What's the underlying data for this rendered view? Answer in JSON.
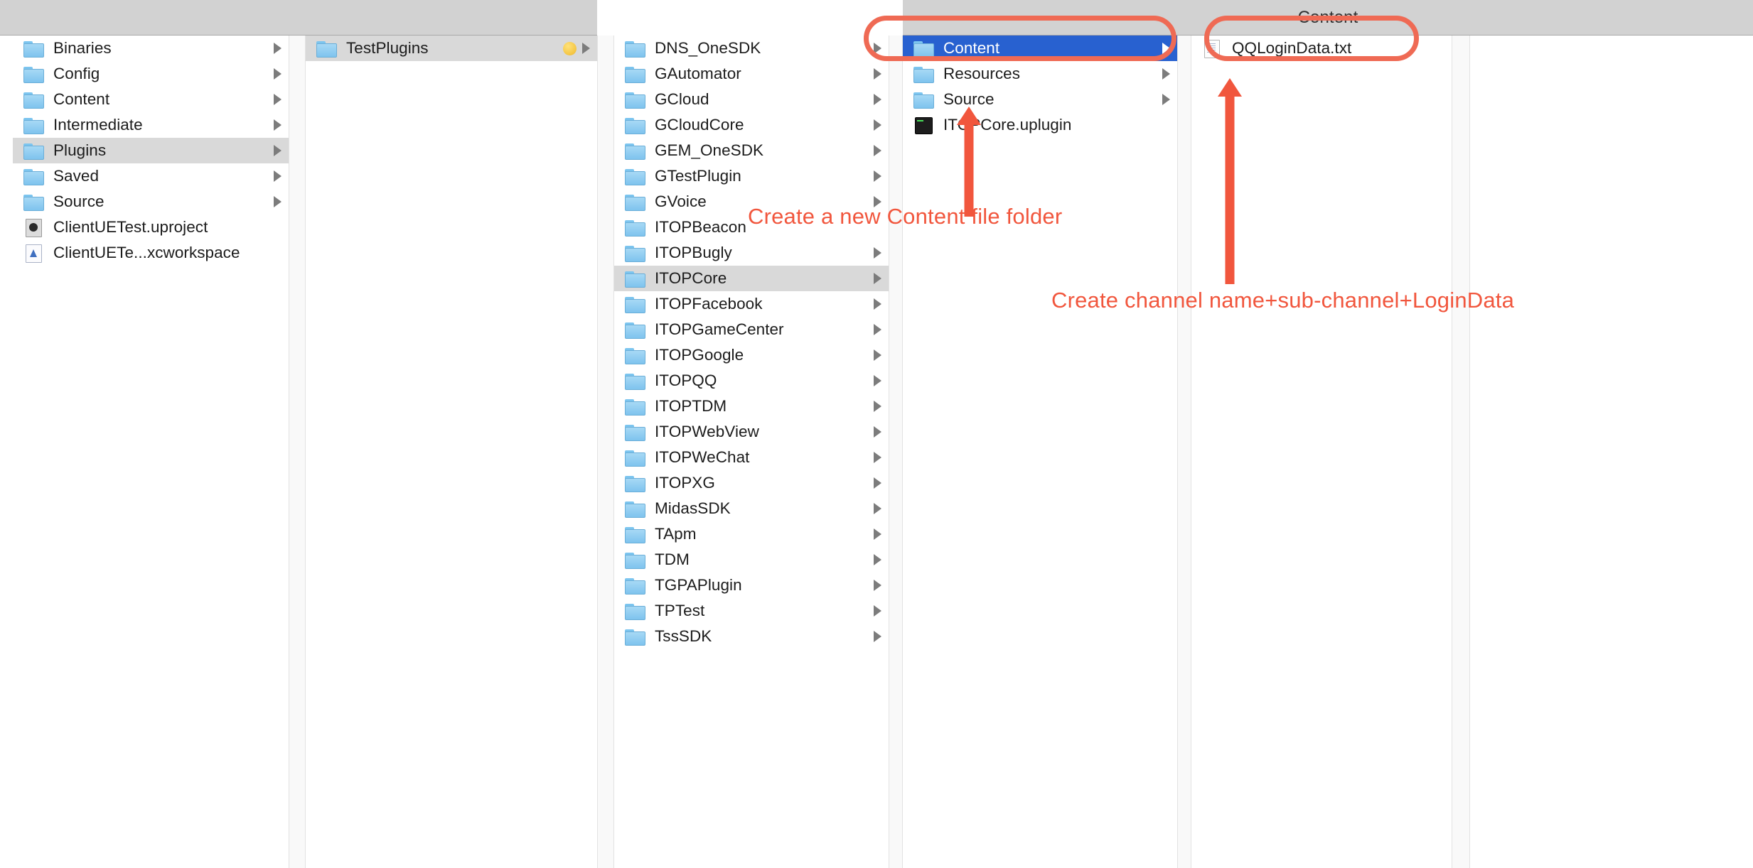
{
  "window": {
    "right_pane_title": "Content",
    "accent_selected": "#2861d0",
    "annotation_color": "#f1563d"
  },
  "columns": [
    {
      "id": "col-1",
      "items": [
        {
          "label": "Binaries",
          "icon": "folder-icon",
          "chevron": true,
          "state": "normal"
        },
        {
          "label": "Config",
          "icon": "folder-icon",
          "chevron": true,
          "state": "normal"
        },
        {
          "label": "Content",
          "icon": "folder-icon",
          "chevron": true,
          "state": "normal"
        },
        {
          "label": "Intermediate",
          "icon": "folder-icon",
          "chevron": true,
          "state": "normal"
        },
        {
          "label": "Plugins",
          "icon": "folder-icon",
          "chevron": true,
          "state": "selected-gray"
        },
        {
          "label": "Saved",
          "icon": "folder-icon",
          "chevron": true,
          "state": "normal"
        },
        {
          "label": "Source",
          "icon": "folder-icon",
          "chevron": true,
          "state": "normal"
        },
        {
          "label": "ClientUETest.uproject",
          "icon": "unreal-project-icon",
          "chevron": false,
          "state": "normal"
        },
        {
          "label": "ClientUETe...xcworkspace",
          "icon": "xcode-workspace-icon",
          "chevron": false,
          "state": "normal"
        }
      ]
    },
    {
      "id": "col-2",
      "items": [
        {
          "label": "TestPlugins",
          "icon": "folder-icon",
          "chevron": true,
          "state": "selected-gray",
          "tag": "yellow-tag-dot"
        }
      ]
    },
    {
      "id": "col-3",
      "items": [
        {
          "label": "DNS_OneSDK",
          "icon": "folder-icon",
          "chevron": true,
          "state": "normal"
        },
        {
          "label": "GAutomator",
          "icon": "folder-icon",
          "chevron": true,
          "state": "normal"
        },
        {
          "label": "GCloud",
          "icon": "folder-icon",
          "chevron": true,
          "state": "normal"
        },
        {
          "label": "GCloudCore",
          "icon": "folder-icon",
          "chevron": true,
          "state": "normal"
        },
        {
          "label": "GEM_OneSDK",
          "icon": "folder-icon",
          "chevron": true,
          "state": "normal"
        },
        {
          "label": "GTestPlugin",
          "icon": "folder-icon",
          "chevron": true,
          "state": "normal"
        },
        {
          "label": "GVoice",
          "icon": "folder-icon",
          "chevron": true,
          "state": "normal"
        },
        {
          "label": "ITOPBeacon",
          "icon": "folder-icon",
          "chevron": false,
          "state": "normal"
        },
        {
          "label": "ITOPBugly",
          "icon": "folder-icon",
          "chevron": true,
          "state": "normal"
        },
        {
          "label": "ITOPCore",
          "icon": "folder-icon",
          "chevron": true,
          "state": "selected-gray"
        },
        {
          "label": "ITOPFacebook",
          "icon": "folder-icon",
          "chevron": true,
          "state": "normal"
        },
        {
          "label": "ITOPGameCenter",
          "icon": "folder-icon",
          "chevron": true,
          "state": "normal"
        },
        {
          "label": "ITOPGoogle",
          "icon": "folder-icon",
          "chevron": true,
          "state": "normal"
        },
        {
          "label": "ITOPQQ",
          "icon": "folder-icon",
          "chevron": true,
          "state": "normal"
        },
        {
          "label": "ITOPTDM",
          "icon": "folder-icon",
          "chevron": true,
          "state": "normal"
        },
        {
          "label": "ITOPWebView",
          "icon": "folder-icon",
          "chevron": true,
          "state": "normal"
        },
        {
          "label": "ITOPWeChat",
          "icon": "folder-icon",
          "chevron": true,
          "state": "normal"
        },
        {
          "label": "ITOPXG",
          "icon": "folder-icon",
          "chevron": true,
          "state": "normal"
        },
        {
          "label": "MidasSDK",
          "icon": "folder-icon",
          "chevron": true,
          "state": "normal"
        },
        {
          "label": "TApm",
          "icon": "folder-icon",
          "chevron": true,
          "state": "normal"
        },
        {
          "label": "TDM",
          "icon": "folder-icon",
          "chevron": true,
          "state": "normal"
        },
        {
          "label": "TGPAPlugin",
          "icon": "folder-icon",
          "chevron": true,
          "state": "normal"
        },
        {
          "label": "TPTest",
          "icon": "folder-icon",
          "chevron": true,
          "state": "normal"
        },
        {
          "label": "TssSDK",
          "icon": "folder-icon",
          "chevron": true,
          "state": "normal"
        }
      ]
    },
    {
      "id": "col-4",
      "items": [
        {
          "label": "Content",
          "icon": "folder-icon",
          "chevron": true,
          "state": "selected-blue"
        },
        {
          "label": "Resources",
          "icon": "folder-icon",
          "chevron": true,
          "state": "normal"
        },
        {
          "label": "Source",
          "icon": "folder-icon",
          "chevron": true,
          "state": "normal"
        },
        {
          "label": "ITOPCore.uplugin",
          "icon": "uplugin-icon",
          "chevron": false,
          "state": "normal"
        }
      ]
    },
    {
      "id": "col-5",
      "items": [
        {
          "label": "QQLoginData.txt",
          "icon": "text-document-icon",
          "chevron": false,
          "state": "normal"
        }
      ]
    },
    {
      "id": "col-6",
      "items": []
    }
  ],
  "annotations": [
    {
      "id": "anno-content-folder",
      "text": "Create a new Content file folder"
    },
    {
      "id": "anno-login-data-file",
      "text": "Create channel name+sub-channel+LoginData"
    }
  ]
}
